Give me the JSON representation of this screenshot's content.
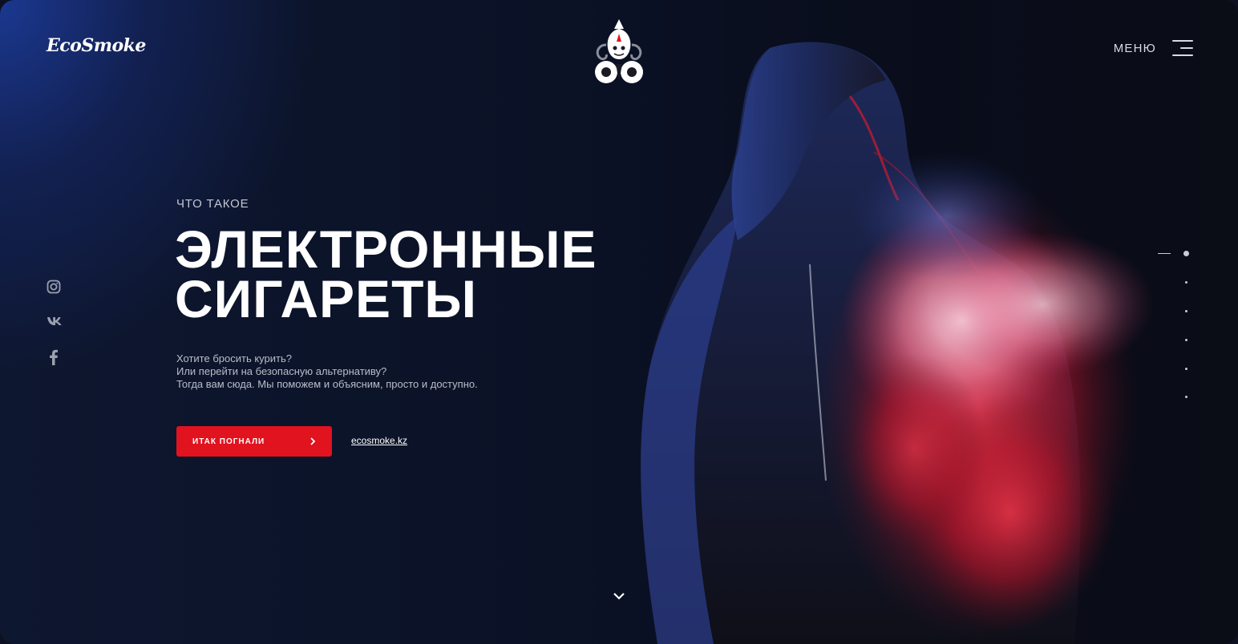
{
  "header": {
    "logo_text": "EcoSmoke",
    "menu_label": "МЕНЮ",
    "menu_icon": "hamburger-icon",
    "emblem": "brand-emblem"
  },
  "social": [
    {
      "name": "instagram",
      "icon": "instagram-icon"
    },
    {
      "name": "vk",
      "icon": "vk-icon"
    },
    {
      "name": "facebook",
      "icon": "facebook-icon"
    }
  ],
  "hero": {
    "kicker": "ЧТО ТАКОЕ",
    "title_line1": "ЭЛЕКТРОННЫЕ",
    "title_line2": "СИГАРЕТЫ",
    "desc_line1": "Хотите бросить курить?",
    "desc_line2": "Или перейти на безопасную альтернативу?",
    "desc_line3": "Тогда вам сюда. Мы поможем и объясним, просто и доступно.",
    "cta_label": "ИТАК ПОГНАЛИ",
    "cta_icon": "chevron-right-icon",
    "link_text": "ecosmoke.kz"
  },
  "pagination": {
    "total": 6,
    "active": 1
  },
  "scroll_icon": "chevron-down-icon",
  "colors": {
    "accent": "#e0131f",
    "background": "#0b1226",
    "text": "#ffffff"
  }
}
